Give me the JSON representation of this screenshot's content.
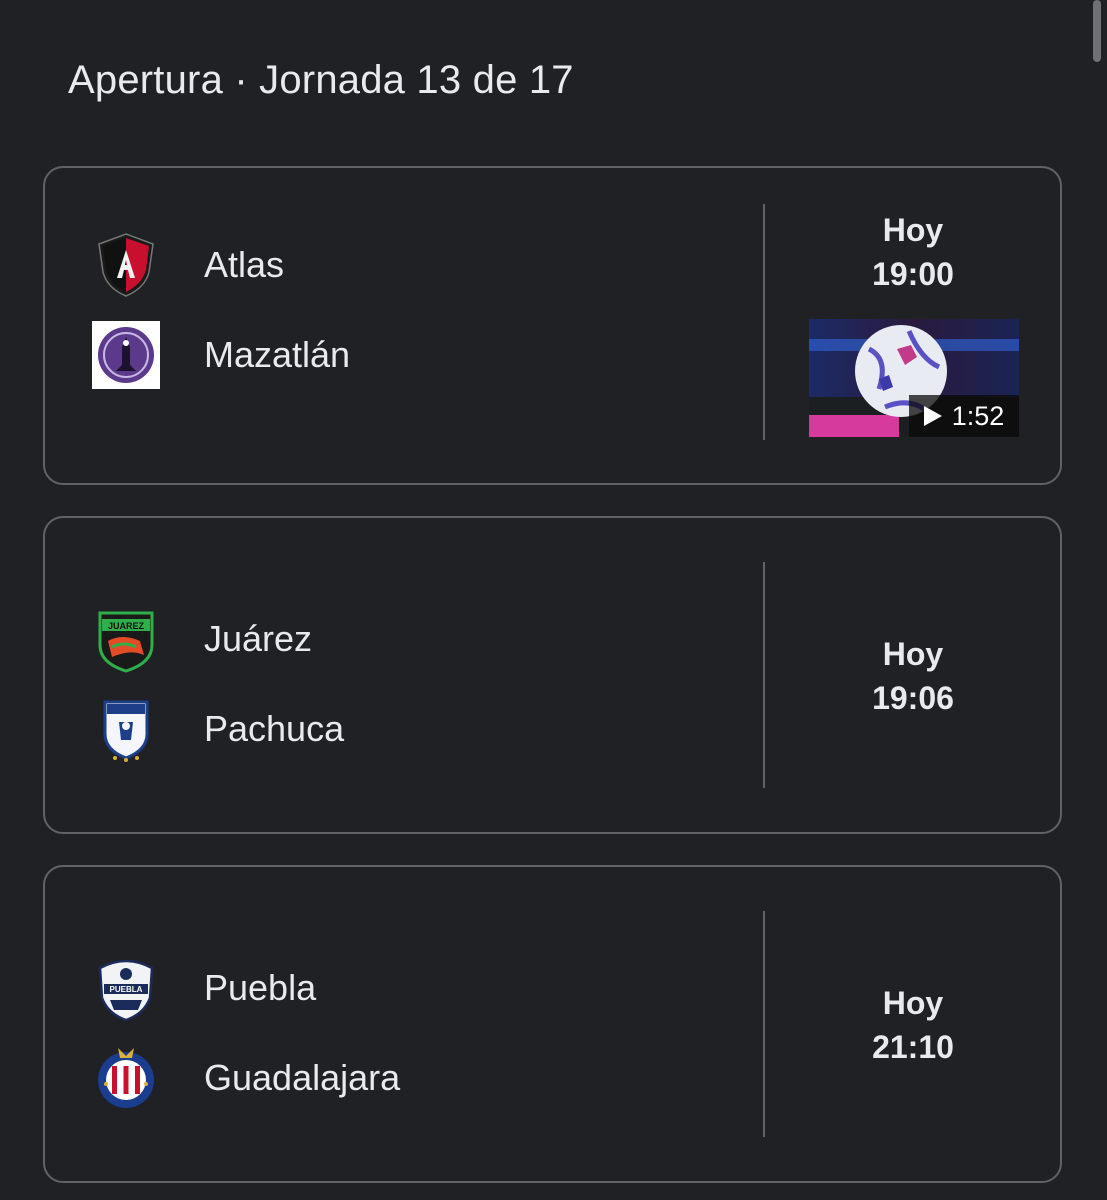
{
  "header": {
    "title": "Apertura · Jornada 13 de 17"
  },
  "matches": [
    {
      "home": {
        "name": "Atlas",
        "logo_icon": "atlas-crest-icon"
      },
      "away": {
        "name": "Mazatlán",
        "logo_icon": "mazatlan-crest-icon"
      },
      "day": "Hoy",
      "time": "19:00",
      "video": {
        "duration": "1:52",
        "icon": "play-icon"
      }
    },
    {
      "home": {
        "name": "Juárez",
        "logo_icon": "juarez-crest-icon"
      },
      "away": {
        "name": "Pachuca",
        "logo_icon": "pachuca-crest-icon"
      },
      "day": "Hoy",
      "time": "19:06"
    },
    {
      "home": {
        "name": "Puebla",
        "logo_icon": "puebla-crest-icon"
      },
      "away": {
        "name": "Guadalajara",
        "logo_icon": "guadalajara-crest-icon"
      },
      "day": "Hoy",
      "time": "21:10"
    }
  ],
  "colors": {
    "background": "#202124",
    "card_border": "#5f6368",
    "text": "#e8eaed"
  }
}
